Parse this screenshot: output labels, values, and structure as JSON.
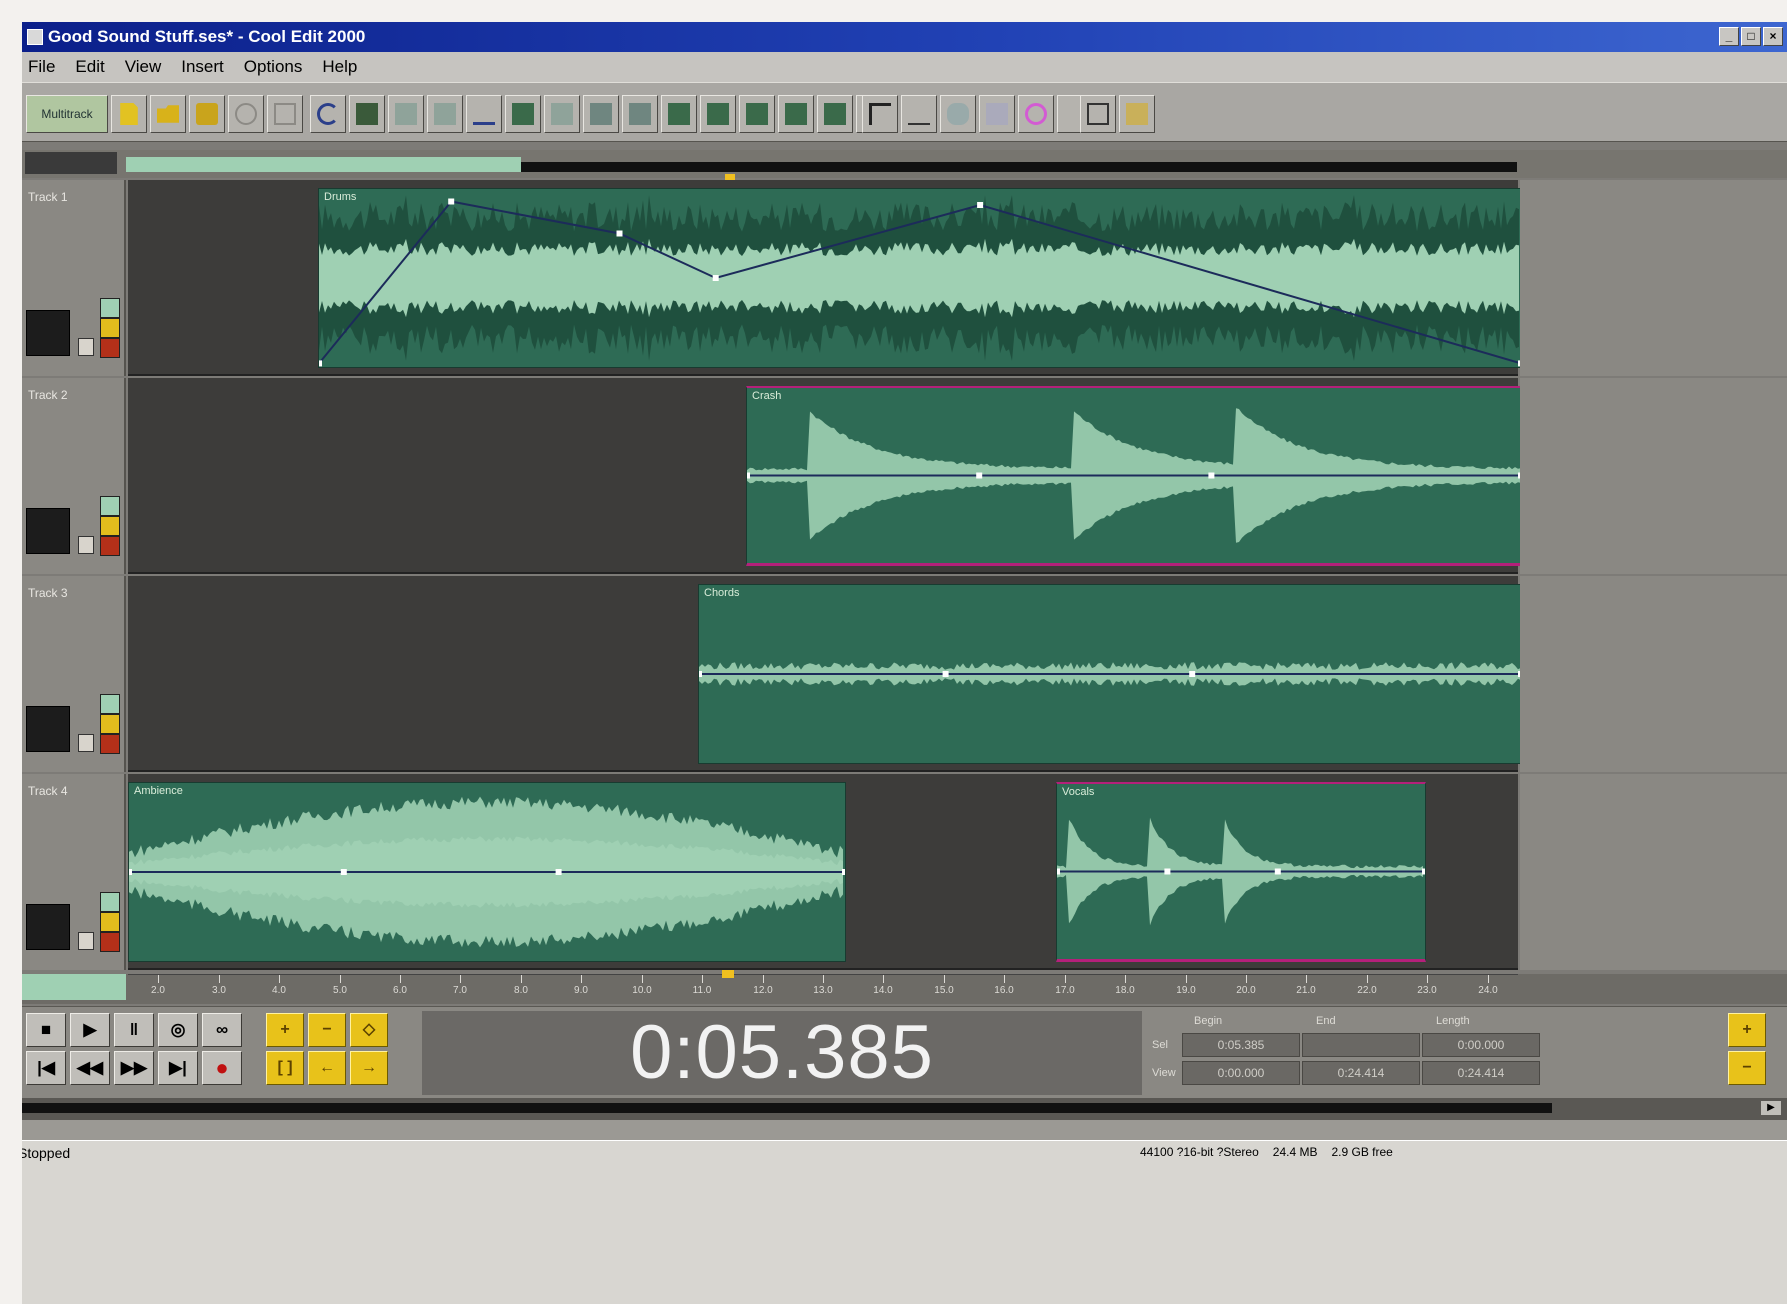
{
  "window": {
    "title": "Good Sound Stuff.ses* - Cool Edit 2000"
  },
  "menu": [
    "File",
    "Edit",
    "View",
    "Insert",
    "Options",
    "Help"
  ],
  "toolbar": {
    "mode_button": "Multitrack"
  },
  "tracks": [
    {
      "name": "Track 1",
      "clips": [
        {
          "name": "Drums"
        }
      ]
    },
    {
      "name": "Track 2",
      "clips": [
        {
          "name": "Crash"
        }
      ]
    },
    {
      "name": "Track 3",
      "clips": [
        {
          "name": "Chords"
        }
      ]
    },
    {
      "name": "Track 4",
      "clips": [
        {
          "name": "Ambience"
        },
        {
          "name": "Vocals"
        }
      ]
    }
  ],
  "ruler": {
    "labels": [
      "2.0",
      "3.0",
      "4.0",
      "5.0",
      "6.0",
      "7.0",
      "8.0",
      "9.0",
      "10.0",
      "11.0",
      "12.0",
      "13.0",
      "14.0",
      "15.0",
      "16.0",
      "17.0",
      "18.0",
      "19.0",
      "20.0",
      "21.0",
      "22.0",
      "23.0",
      "24.0"
    ]
  },
  "transport": {
    "time": "0:05.385"
  },
  "selection_panel": {
    "headers": [
      "Begin",
      "End",
      "Length"
    ],
    "sel_label": "Sel",
    "view_label": "View",
    "sel_values": [
      "0:05.385",
      "",
      "0:00.000"
    ],
    "view_values": [
      "0:00.000",
      "0:24.414",
      "0:24.414"
    ]
  },
  "status": {
    "left": "Stopped",
    "format": "44100 ?16-bit ?Stereo",
    "size": "24.4 MB",
    "free": "2.9 GB free"
  },
  "colors": {
    "clip_bg": "#2e6b55",
    "wave_light": "#9fd0b3",
    "wave_dark": "#1e4e3c",
    "envelope": "#1c2b5a",
    "title_bar": "#0b1f8a"
  }
}
